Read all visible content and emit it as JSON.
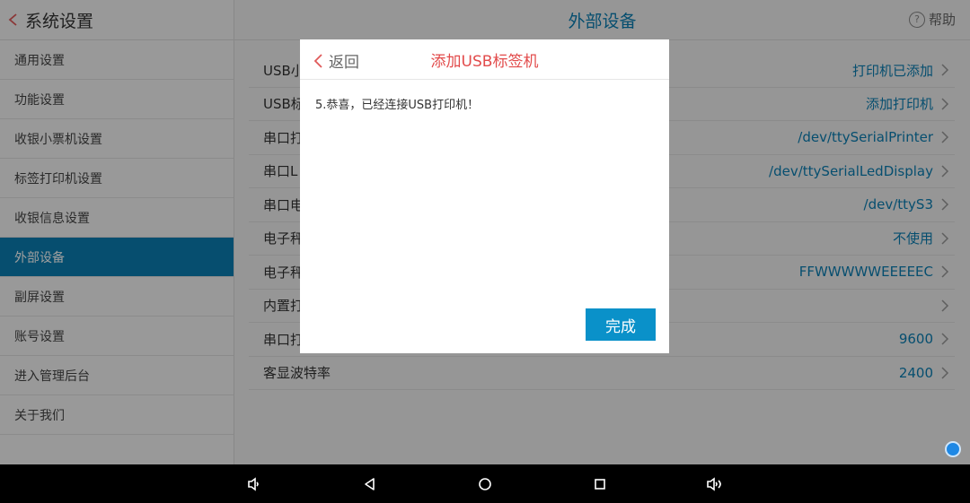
{
  "sidebar": {
    "title": "系统设置",
    "items": [
      {
        "label": "通用设置"
      },
      {
        "label": "功能设置"
      },
      {
        "label": "收银小票机设置"
      },
      {
        "label": "标签打印机设置"
      },
      {
        "label": "收银信息设置"
      },
      {
        "label": "外部设备",
        "active": true
      },
      {
        "label": "副屏设置"
      },
      {
        "label": "账号设置"
      },
      {
        "label": "进入管理后台"
      },
      {
        "label": "关于我们"
      }
    ]
  },
  "main": {
    "title": "外部设备",
    "help_label": "帮助",
    "help_icon_glyph": "?",
    "rows": [
      {
        "label": "USB小",
        "value": "打印机已添加"
      },
      {
        "label": "USB标",
        "value": "添加打印机"
      },
      {
        "label": "串口打",
        "value": "/dev/ttySerialPrinter"
      },
      {
        "label": "串口L",
        "value": "/dev/ttySerialLedDisplay"
      },
      {
        "label": "串口电",
        "value": "/dev/ttyS3"
      },
      {
        "label": "电子秤",
        "value": "不使用"
      },
      {
        "label": "电子秤",
        "value": "FFWWWWWEEEEEC"
      },
      {
        "label": "内置打",
        "value": ""
      },
      {
        "label": "串口打",
        "value": "9600"
      },
      {
        "label": "客显波特率",
        "value": "2400"
      }
    ]
  },
  "dialog": {
    "back_label": "返回",
    "title": "添加USB标签机",
    "message": "5.恭喜，已经连接USB打印机！",
    "done_label": "完成"
  },
  "colors": {
    "accent": "#0a7fb4",
    "dialog_title": "#e24b4b",
    "done_button": "#0a91c9"
  },
  "navbar": {
    "buttons": [
      "volume-down-icon",
      "back-icon",
      "home-icon",
      "recents-icon",
      "volume-up-icon"
    ]
  }
}
